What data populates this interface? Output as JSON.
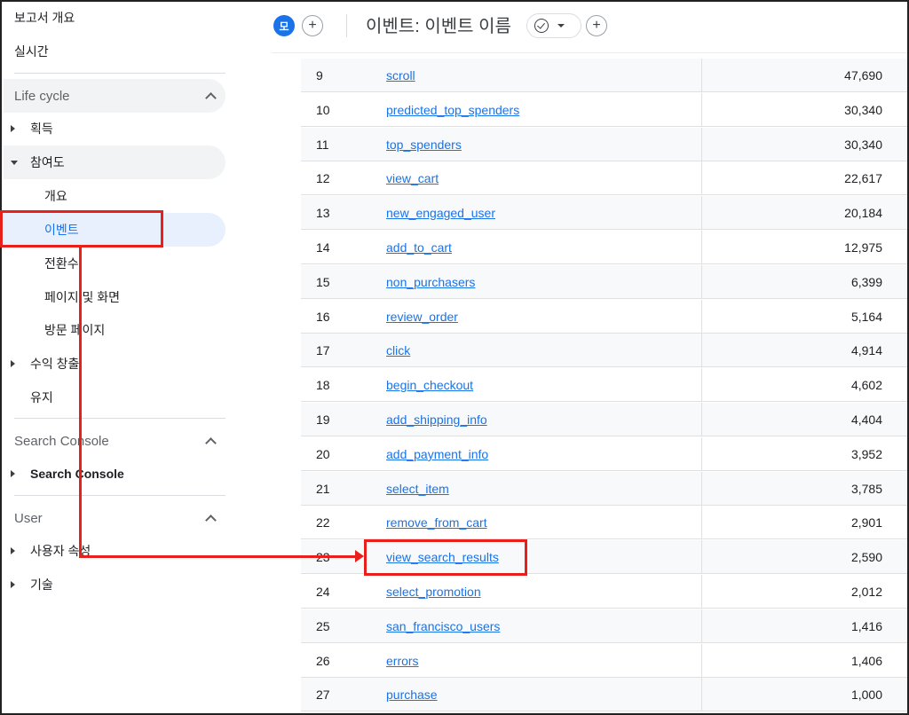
{
  "sidebar": {
    "top_items": [
      "보고서 개요",
      "실시간"
    ],
    "lifecycle": {
      "header": "Life cycle",
      "acquisition": "획득",
      "engagement": "참여도",
      "engagement_children": [
        "개요",
        "이벤트",
        "전환수",
        "페이지 및 화면",
        "방문 페이지"
      ],
      "monetization": "수익 창출",
      "retention": "유지"
    },
    "search_console": {
      "header": "Search Console",
      "item": "Search Console"
    },
    "user": {
      "header": "User",
      "items": [
        "사용자 속성",
        "기술"
      ]
    }
  },
  "header": {
    "avatar_letter": "모",
    "title": "이벤트: 이벤트 이름"
  },
  "table": {
    "rows": [
      {
        "rank": "9",
        "event": "scroll",
        "count": "47,690"
      },
      {
        "rank": "10",
        "event": "predicted_top_spenders",
        "count": "30,340"
      },
      {
        "rank": "11",
        "event": "top_spenders",
        "count": "30,340"
      },
      {
        "rank": "12",
        "event": "view_cart",
        "count": "22,617"
      },
      {
        "rank": "13",
        "event": "new_engaged_user",
        "count": "20,184"
      },
      {
        "rank": "14",
        "event": "add_to_cart",
        "count": "12,975"
      },
      {
        "rank": "15",
        "event": "non_purchasers",
        "count": "6,399"
      },
      {
        "rank": "16",
        "event": "review_order",
        "count": "5,164"
      },
      {
        "rank": "17",
        "event": "click",
        "count": "4,914"
      },
      {
        "rank": "18",
        "event": "begin_checkout",
        "count": "4,602"
      },
      {
        "rank": "19",
        "event": "add_shipping_info",
        "count": "4,404"
      },
      {
        "rank": "20",
        "event": "add_payment_info",
        "count": "3,952"
      },
      {
        "rank": "21",
        "event": "select_item",
        "count": "3,785"
      },
      {
        "rank": "22",
        "event": "remove_from_cart",
        "count": "2,901"
      },
      {
        "rank": "23",
        "event": "view_search_results",
        "count": "2,590"
      },
      {
        "rank": "24",
        "event": "select_promotion",
        "count": "2,012"
      },
      {
        "rank": "25",
        "event": "san_francisco_users",
        "count": "1,416"
      },
      {
        "rank": "26",
        "event": "errors",
        "count": "1,406"
      },
      {
        "rank": "27",
        "event": "purchase",
        "count": "1,000"
      }
    ]
  },
  "colors": {
    "accent": "#1a73e8",
    "annotation": "#e8201c",
    "selected_bg": "#e8f0fe"
  }
}
